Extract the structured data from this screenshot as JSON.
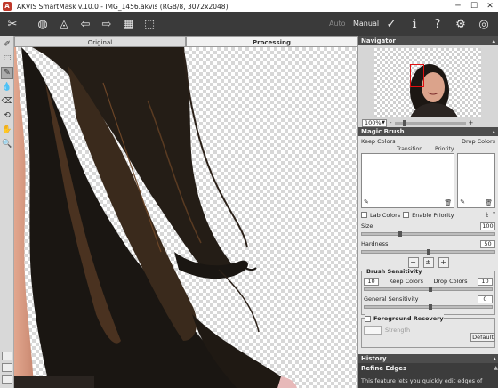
{
  "window": {
    "title": "AKVIS SmartMask v.10.0 - IMG_1456.akvis (RGB/8, 3072x2048)",
    "app_icon": "akvis-logo",
    "controls": [
      "─",
      "☐",
      "✕"
    ]
  },
  "toolbar": {
    "mode_auto": "Auto",
    "mode_manual": "Manual",
    "left_icons": [
      "✂",
      "◍",
      "◬",
      "⇦",
      "⇨",
      "▦",
      "⬚"
    ],
    "right_icons": [
      "✓",
      "ℹ",
      "?",
      "⚙",
      "◎"
    ]
  },
  "canvas": {
    "tab_original": "Original",
    "tab_processing": "Processing"
  },
  "left_tools": [
    "✐",
    "⬚",
    "✎",
    "💧",
    "⌫",
    "⟲",
    "✋",
    "🔍"
  ],
  "navigator": {
    "title": "Navigator",
    "zoom": "100%",
    "zoom_minus": "-",
    "zoom_plus": "+",
    "zoom_level": 0.12
  },
  "magic_brush": {
    "title": "Magic Brush",
    "keep_colors": "Keep Colors",
    "drop_colors": "Drop Colors",
    "col_transition": "Transition",
    "col_priority": "Priority",
    "lab_colors": "Lab Colors",
    "enable_priority": "Enable Priority",
    "size_label": "Size",
    "size_value": "100",
    "size_level": 0.28,
    "hardness_label": "Hardness",
    "hardness_value": "50",
    "hardness_level": 0.5,
    "brush_sensitivity": "Brush Sensitivity",
    "keep_colors_value": "10",
    "keep_colors_label": "Keep Colors",
    "drop_colors_label": "Drop Colors",
    "drop_colors_value": "10",
    "general_sensitivity": "General Sensitivity",
    "general_value": "0",
    "foreground_recovery": "Foreground Recovery",
    "strength": "Strength",
    "default_button": "Default"
  },
  "history": {
    "title": "History",
    "body_title": "Refine Edges",
    "body_text": "This feature lets you quickly edit edges of"
  }
}
